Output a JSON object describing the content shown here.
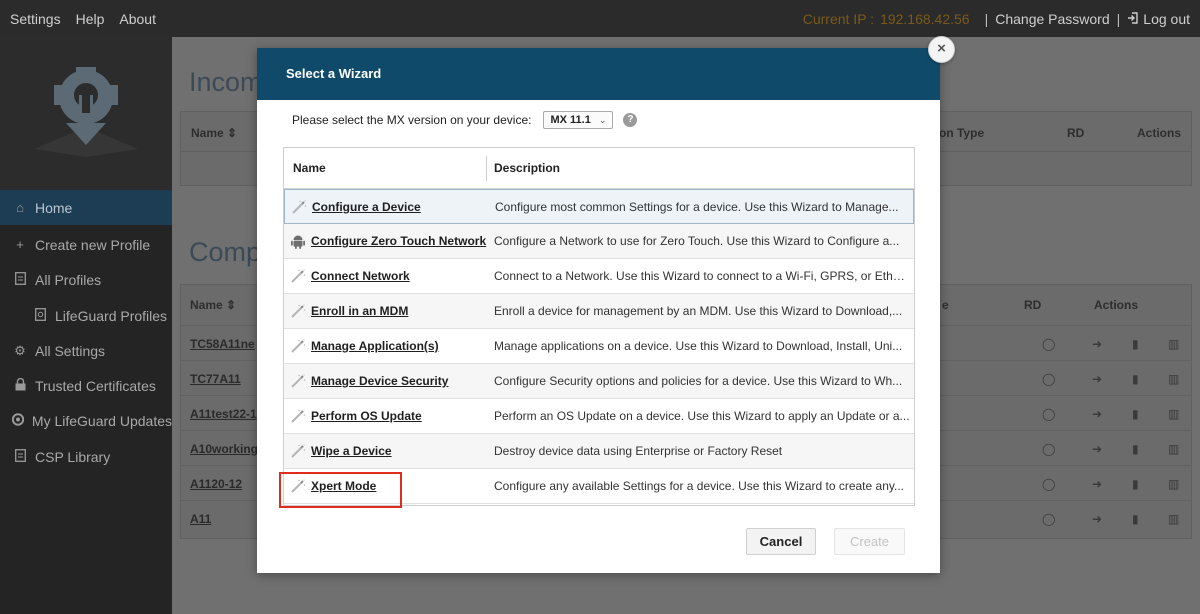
{
  "topbar": {
    "nav": [
      "Settings",
      "Help",
      "About"
    ],
    "current_ip_label": "Current IP :",
    "current_ip_value": "192.168.42.56",
    "change_password": "Change Password",
    "separator": "|",
    "logout": "Log out"
  },
  "sidebar": {
    "items": [
      {
        "icon": "home-icon",
        "label": "Home",
        "active": true
      },
      {
        "icon": "plus-icon",
        "label": "Create new Profile"
      },
      {
        "icon": "file-icon",
        "label": "All Profiles"
      },
      {
        "icon": "file-shield-icon",
        "label": "LifeGuard Profiles",
        "sub": true
      },
      {
        "icon": "gear-icon",
        "label": "All Settings"
      },
      {
        "icon": "lock-icon",
        "label": "Trusted Certificates"
      },
      {
        "icon": "shield-icon",
        "label": "My LifeGuard Updates"
      },
      {
        "icon": "file-icon",
        "label": "CSP Library"
      }
    ]
  },
  "background": {
    "incomplete_title": "Incom",
    "complete_title": "Comp",
    "col_name": "Name",
    "col_type": "on Type",
    "col_type2": "e",
    "col_rd": "RD",
    "col_actions": "Actions",
    "rows": [
      "TC58A11ne",
      "TC77A11",
      "A11test22-1",
      "A10working",
      "A1120-12",
      "A11"
    ]
  },
  "modal": {
    "title": "Select a Wizard",
    "close_label": "×",
    "mx_prompt": "Please select the MX version on your device:",
    "mx_value": "MX 11.1",
    "table_header": {
      "name": "Name",
      "description": "Description"
    },
    "wizards": [
      {
        "name": "Configure a Device",
        "description": "Configure most common Settings for a device. Use this Wizard to Manage...",
        "icon": "wand-icon"
      },
      {
        "name": "Configure Zero Touch Network",
        "description": "Configure a Network to use for Zero Touch. Use this Wizard to Configure a...",
        "icon": "android-icon"
      },
      {
        "name": "Connect Network",
        "description": "Connect to a Network. Use this Wizard to connect to a Wi-Fi, GPRS, or Ether...",
        "icon": "wand-icon"
      },
      {
        "name": "Enroll in an MDM",
        "description": "Enroll a device for management by an MDM.  Use this Wizard to Download,...",
        "icon": "wand-icon"
      },
      {
        "name": "Manage Application(s)",
        "description": "Manage applications on a device.  Use this Wizard to Download, Install, Uni...",
        "icon": "wand-icon"
      },
      {
        "name": "Manage Device Security",
        "description": "Configure Security options and policies for a device.  Use this Wizard to Wh...",
        "icon": "wand-icon"
      },
      {
        "name": "Perform OS Update",
        "description": "Perform an OS Update on a device.  Use this Wizard to apply an Update or a...",
        "icon": "wand-icon"
      },
      {
        "name": "Wipe a Device",
        "description": "Destroy device data using Enterprise or Factory Reset",
        "icon": "wand-icon"
      },
      {
        "name": "Xpert Mode",
        "description": "Configure any available Settings for a device. Use this Wizard to create any...",
        "icon": "wand-icon"
      }
    ],
    "cancel_label": "Cancel",
    "create_label": "Create"
  }
}
